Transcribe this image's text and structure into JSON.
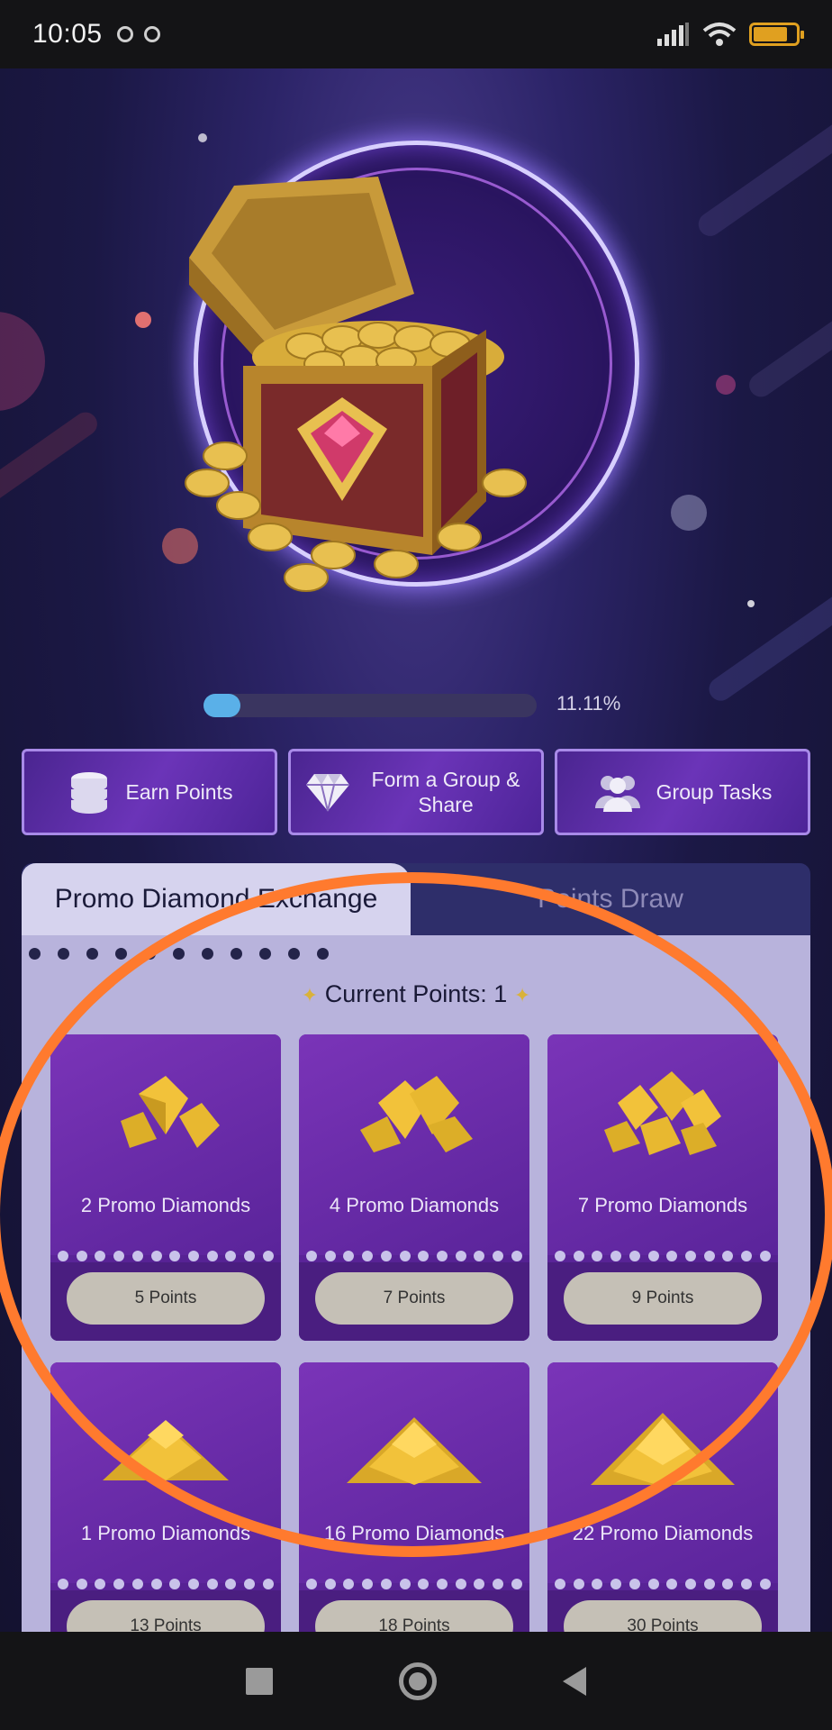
{
  "status_bar": {
    "time": "10:05",
    "battery_color": "#e0a020"
  },
  "hero": {
    "progress_percent": 11.11,
    "progress_label": "11.11%",
    "progress_color": "#5ab0e8"
  },
  "actions": [
    {
      "label": "Earn Points",
      "icon": "coins-stack-icon"
    },
    {
      "label": "Form a Group & Share",
      "icon": "diamond-icon"
    },
    {
      "label": "Group Tasks",
      "icon": "group-people-icon"
    }
  ],
  "tabs": [
    {
      "label": "Promo Diamond Exchange",
      "active": true
    },
    {
      "label": "Points Draw",
      "active": false
    }
  ],
  "current_points_label": "Current Points: 1",
  "rewards": [
    {
      "title": "2 Promo Diamonds",
      "price": "5 Points"
    },
    {
      "title": "4 Promo Diamonds",
      "price": "7 Points"
    },
    {
      "title": "7 Promo Diamonds",
      "price": "9 Points"
    },
    {
      "title": "1 Promo Diamonds",
      "price": "13 Points"
    },
    {
      "title": "16 Promo Diamonds",
      "price": "18 Points"
    },
    {
      "title": "22 Promo Diamonds",
      "price": "30 Points"
    }
  ],
  "annotation_color": "#ff7a2e"
}
